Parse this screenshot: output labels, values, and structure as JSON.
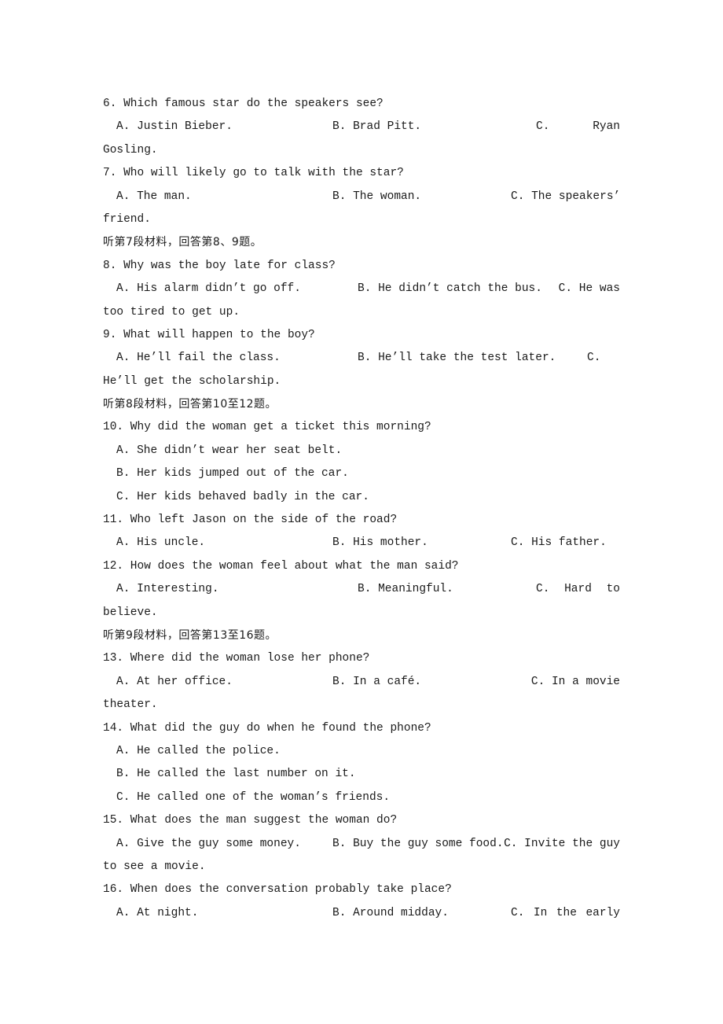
{
  "questions": {
    "q6": {
      "stem": "6. Which famous star do the speakers see?",
      "a": "A. Justin Bieber.",
      "b": "B. Brad Pitt.",
      "c_label": "C.",
      "c_first": "Ryan",
      "c_cont": "Gosling."
    },
    "q7": {
      "stem": "7. Who will likely go to talk with the star?",
      "a": "A. The man.",
      "b": "B. The woman.",
      "c": "C. The speakers’",
      "c_cont": "friend."
    },
    "section7": "听第7段材料，回答第8、9题。",
    "q8": {
      "stem": "8. Why was the boy late for class?",
      "a": "A. His alarm didn’t go off.",
      "b": "B. He didn’t catch the bus.",
      "c": "C. He was",
      "c_cont": "too tired to get up."
    },
    "q9": {
      "stem": "9. What will happen to the boy?",
      "a": "A. He’ll fail the class.",
      "b": "B. He’ll take the test later.",
      "c_label": "C.",
      "c_cont": "He’ll get the scholarship."
    },
    "section8": "听第8段材料，回答第10至12题。",
    "q10": {
      "stem": "10. Why did the woman get a ticket this morning?",
      "a": "A. She didn’t wear her seat belt.",
      "b": "B. Her kids jumped out of the car.",
      "c": "C. Her kids behaved badly in the car."
    },
    "q11": {
      "stem": "11. Who left Jason on the side of the road?",
      "a": "A. His uncle.",
      "b": "B. His mother.",
      "c": "C. His father."
    },
    "q12": {
      "stem": "12. How does the woman feel about what the man said?",
      "a": "A. Interesting.",
      "b": "B. Meaningful.",
      "c_label": "C.",
      "c_w1": "Hard",
      "c_w2": "to",
      "c_cont": "believe."
    },
    "section9": "听第9段材料，回答第13至16题。",
    "q13": {
      "stem": "13. Where did the woman lose her phone?",
      "a": "A. At her office.",
      "b": "B. In a café.",
      "c": "C. In a movie",
      "c_cont": "theater."
    },
    "q14": {
      "stem": "14. What did the guy do when he found the phone?",
      "a": "A. He called the police.",
      "b": "B. He called the last number on it.",
      "c": "C. He called one of the woman’s friends."
    },
    "q15": {
      "stem": "15. What does the man suggest the woman do?",
      "a": "A. Give the guy some money.",
      "b": "B. Buy the guy some food.",
      "c": "C. Invite the guy",
      "c_cont": "to see a movie."
    },
    "q16": {
      "stem": "16. When does the conversation probably take place?",
      "a": "A. At night.",
      "b": "B. Around midday.",
      "c_label": "C.",
      "c_w1": "In",
      "c_w2": "the",
      "c_w3": "early"
    }
  }
}
